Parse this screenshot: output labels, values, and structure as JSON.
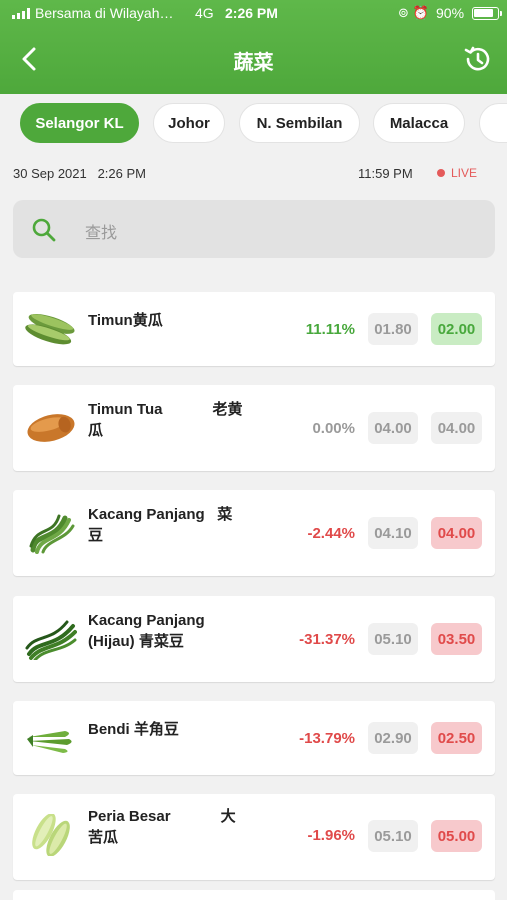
{
  "status_bar": {
    "carrier": "Bersama di Wilayah…",
    "network": "4G",
    "time": "2:26 PM",
    "battery": "90%"
  },
  "header": {
    "title": "蔬菜",
    "back_icon": "chevron-left-icon",
    "history_icon": "history-icon"
  },
  "regions": [
    {
      "label": "Selangor KL",
      "active": true
    },
    {
      "label": "Johor",
      "active": false
    },
    {
      "label": "N. Sembilan",
      "active": false
    },
    {
      "label": "Malacca",
      "active": false
    }
  ],
  "info": {
    "date": "30 Sep 2021   2:26 PM",
    "time": "11:59 PM",
    "live": "LIVE"
  },
  "search": {
    "placeholder": "查找"
  },
  "colors": {
    "brand": "#4ea83b",
    "up": "#48a83c",
    "down": "#e04a4a",
    "live": "#e45a5a"
  },
  "items": [
    {
      "name_line1": "Timun黄瓜",
      "name_line2": "",
      "change": "11.11%",
      "previous": "01.80",
      "current": "02.00",
      "trend": "up",
      "image": "cucumber"
    },
    {
      "name_line1": "Timun Tua            老黄",
      "name_line2": "瓜",
      "change": "0.00%",
      "previous": "04.00",
      "current": "04.00",
      "trend": "flat",
      "image": "old-cucumber"
    },
    {
      "name_line1": "Kacang Panjang   菜",
      "name_line2": "豆",
      "change": "-2.44%",
      "previous": "04.10",
      "current": "04.00",
      "trend": "down",
      "image": "long-beans"
    },
    {
      "name_line1": "Kacang Panjang",
      "name_line2": "(Hijau) 青菜豆",
      "change": "-31.37%",
      "previous": "05.10",
      "current": "03.50",
      "trend": "down",
      "image": "green-long-beans"
    },
    {
      "name_line1": "Bendi 羊角豆",
      "name_line2": "",
      "change": "-13.79%",
      "previous": "02.90",
      "current": "02.50",
      "trend": "down",
      "image": "okra"
    },
    {
      "name_line1": "Peria Besar            大",
      "name_line2": "苦瓜",
      "change": "-1.96%",
      "previous": "05.10",
      "current": "05.00",
      "trend": "down",
      "image": "bitter-gourd"
    }
  ]
}
